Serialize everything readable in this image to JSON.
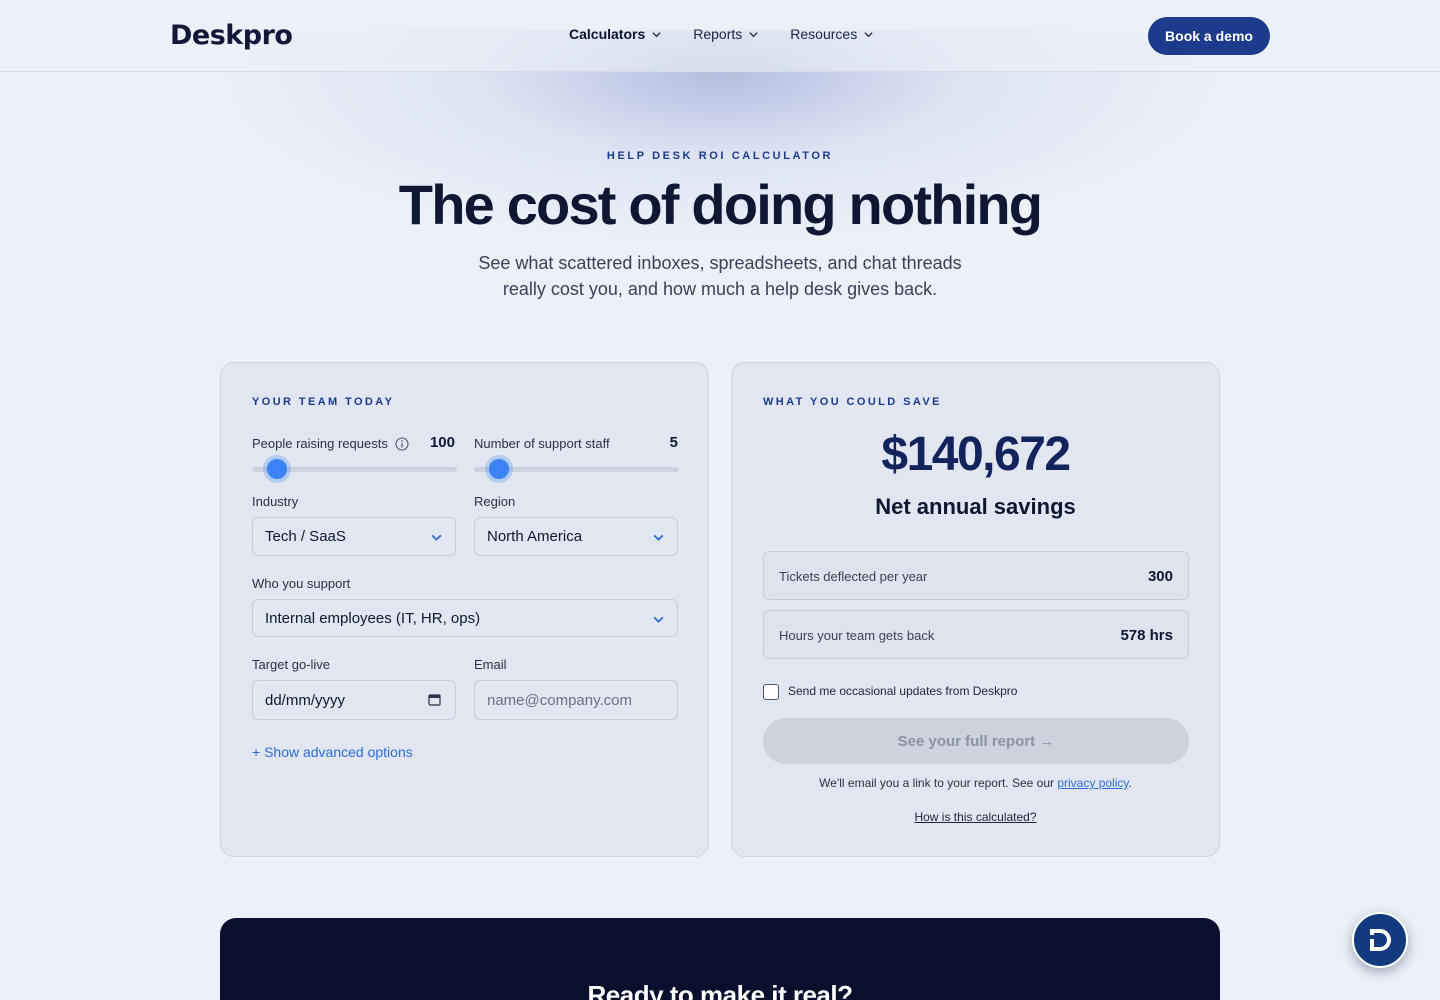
{
  "header": {
    "logo_text": "Deskpro",
    "nav": [
      {
        "label": "Calculators"
      },
      {
        "label": "Reports"
      },
      {
        "label": "Resources"
      }
    ],
    "cta_label": "Book a demo"
  },
  "hero": {
    "eyebrow": "HELP DESK ROI CALCULATOR",
    "title": "The cost of doing nothing",
    "subtitle_line1": "See what scattered inboxes, spreadsheets, and chat threads",
    "subtitle_line2": "really cost you, and how much a help desk gives back."
  },
  "team_card": {
    "section_label": "YOUR TEAM TODAY",
    "people_label": "People raising requests",
    "people_value": "100",
    "people_slider_fraction": 0.08,
    "staff_label": "Number of support staff",
    "staff_value": "5",
    "staff_slider_fraction": 0.08,
    "industry_label": "Industry",
    "industry_value": "Tech / SaaS",
    "region_label": "Region",
    "region_value": "North America",
    "support_label": "Who you support",
    "support_value": "Internal employees (IT, HR, ops)",
    "golive_label": "Target go-live",
    "golive_placeholder": "dd/mm/yyyy",
    "email_label": "Email",
    "email_placeholder": "name@company.com",
    "advanced_link": "+ Show advanced options"
  },
  "savings_card": {
    "section_label": "WHAT YOU COULD SAVE",
    "amount": "$140,672",
    "amount_caption": "Net annual savings",
    "stats": [
      {
        "label": "Tickets deflected per year",
        "value": "300"
      },
      {
        "label": "Hours your team gets back",
        "value": "578 hrs"
      }
    ],
    "checkbox_label": "Send me occasional updates from Deskpro",
    "report_button": "See your full report →",
    "email_note": "We'll email you a link to your report. See our",
    "privacy_link": "privacy policy",
    "how_link": "How is this calculated?"
  },
  "cta": {
    "title": "Ready to make it real?"
  },
  "icons": {
    "chevron": "chevron-down-icon",
    "info": "info-icon",
    "calendar": "calendar-icon",
    "chat": "deskpro-chat-icon"
  },
  "colors": {
    "brand": "#1c3b8c",
    "accent": "#3b82f6",
    "link": "#2b6cd8",
    "dark": "#0b0f2e"
  }
}
